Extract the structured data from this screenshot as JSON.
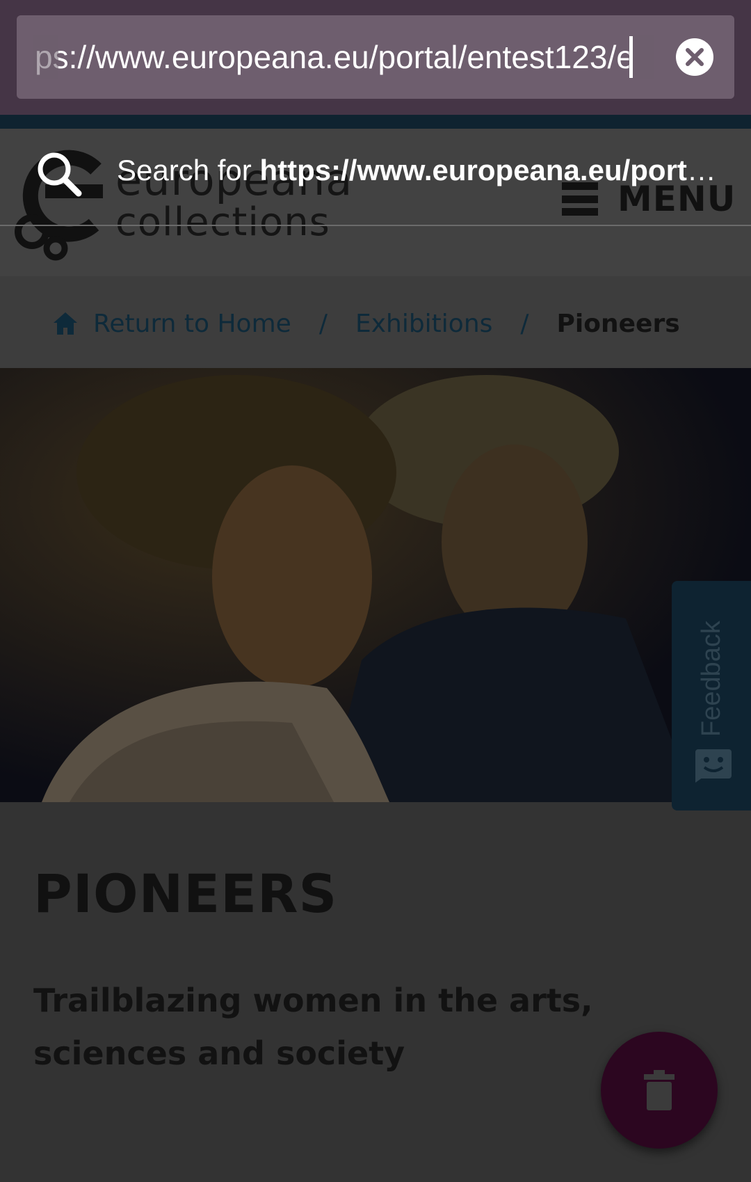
{
  "url_bar": {
    "text": "ps://www.europeana.eu/portal/entest123/e"
  },
  "suggestion": {
    "prefix": "Search for ",
    "query": "https://www.europeana.eu/portal…"
  },
  "header": {
    "logo_word": "europeana",
    "logo_sub": "collections",
    "menu_label": "MENU"
  },
  "breadcrumb": {
    "home": "Return to Home",
    "separator": "/",
    "section": "Exhibitions",
    "current": "Pioneers"
  },
  "feedback": {
    "label": "Feedback"
  },
  "content": {
    "title": "PIONEERS",
    "subtitle": "Trailblazing women in the arts, sciences and society"
  },
  "colors": {
    "url_bar_bg": "#453546",
    "url_field_bg": "#6e5e6e",
    "fab_bg": "#2c0620",
    "feedback_bg": "#0e2331"
  }
}
